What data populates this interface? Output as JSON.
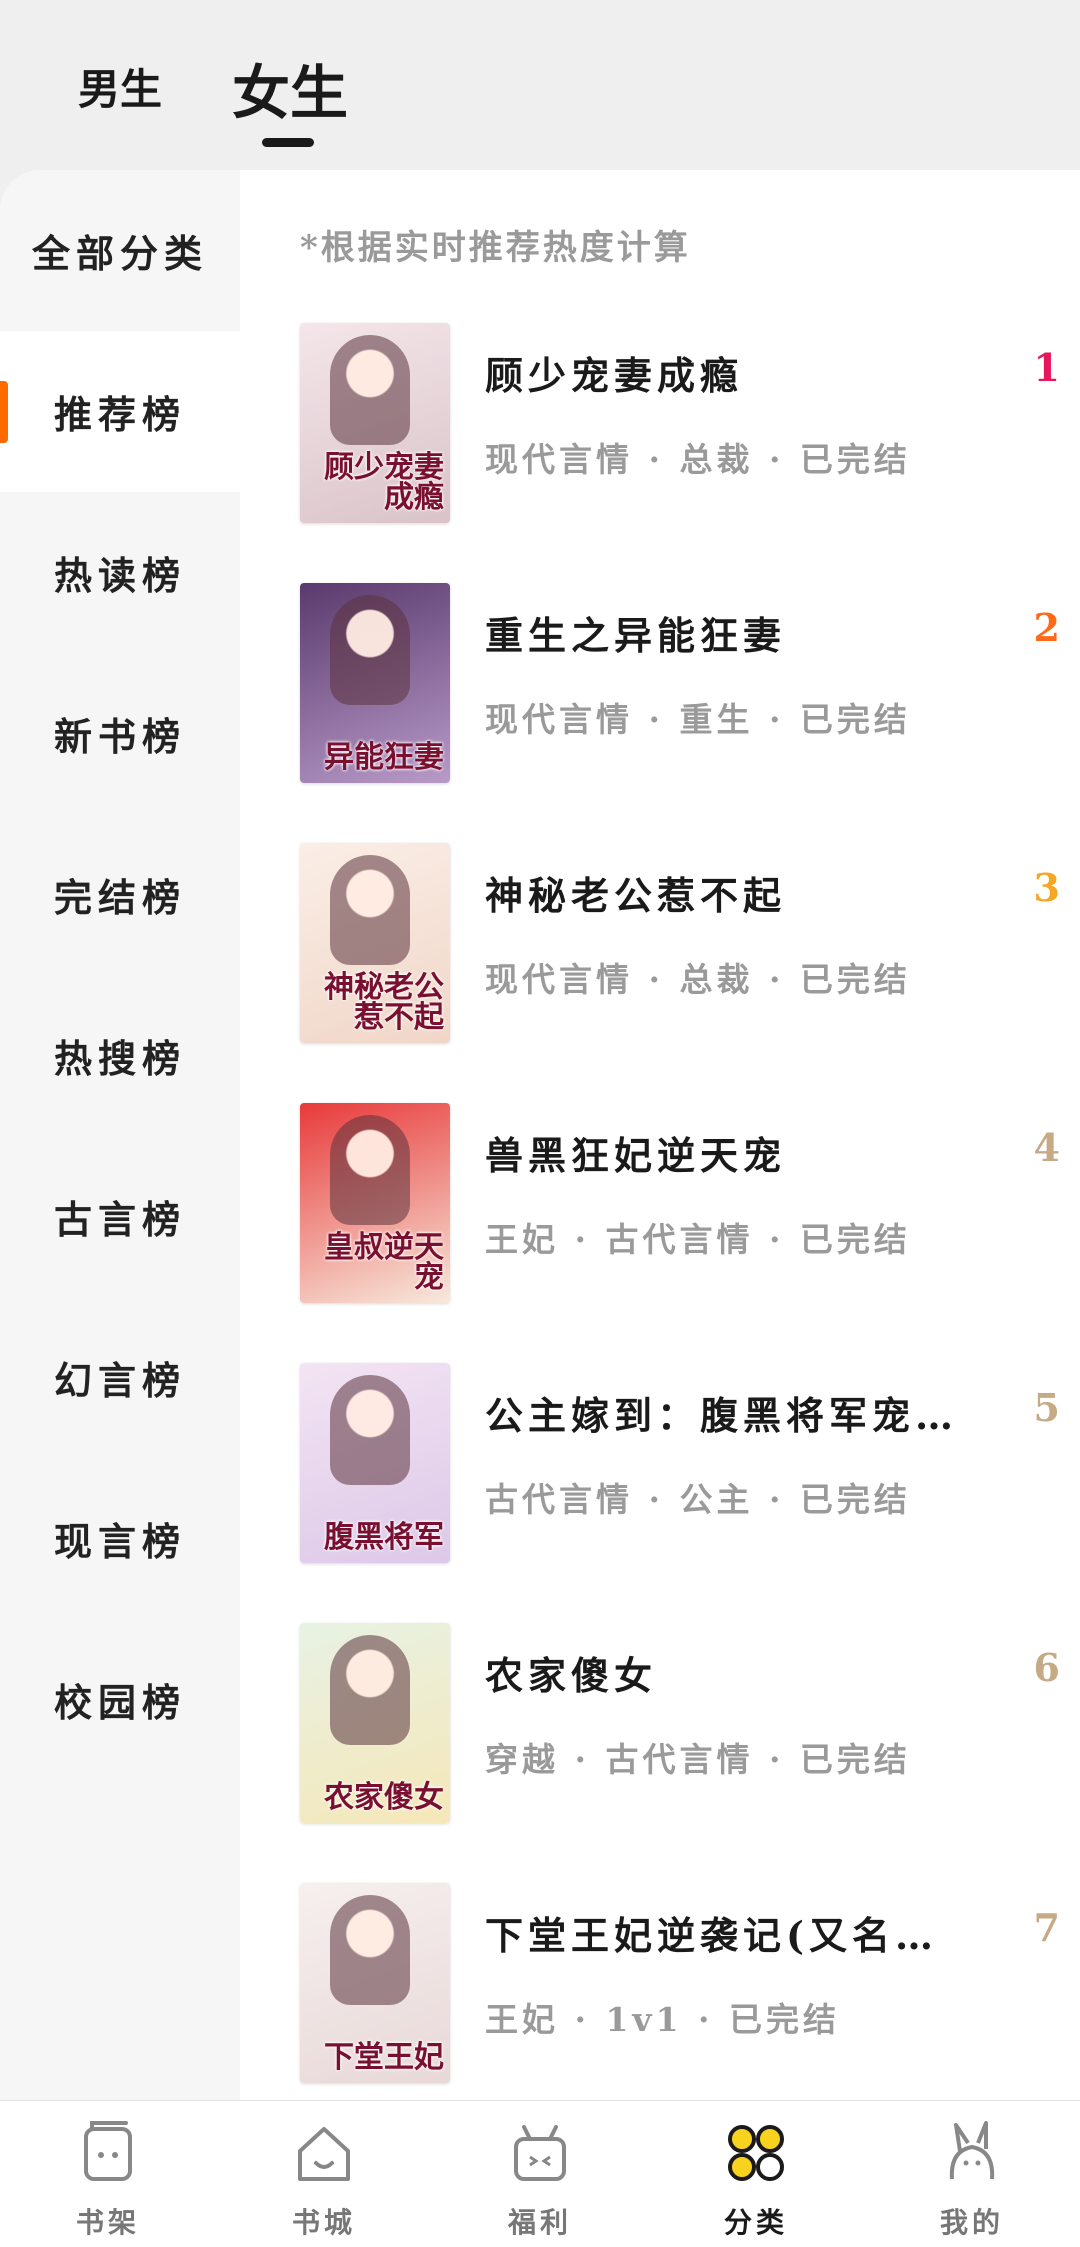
{
  "top_tabs": {
    "male": "男生",
    "female": "女生"
  },
  "sidebar": {
    "items": [
      {
        "label": "全部分类"
      },
      {
        "label": "推荐榜"
      },
      {
        "label": "热读榜"
      },
      {
        "label": "新书榜"
      },
      {
        "label": "完结榜"
      },
      {
        "label": "热搜榜"
      },
      {
        "label": "古言榜"
      },
      {
        "label": "幻言榜"
      },
      {
        "label": "现言榜"
      },
      {
        "label": "校园榜"
      }
    ],
    "active_index": 1,
    "accent_color": "#ff6a00"
  },
  "main": {
    "hint": "*根据实时推荐热度计算",
    "books": [
      {
        "rank": "1",
        "title": "顾少宠妻成瘾",
        "meta": "现代言情 · 总裁 · 已完结",
        "rank_color": "#e8175d",
        "cover_text": "顾少宠妻成瘾",
        "cover_colors": [
          "#f4e6ea",
          "#d9c3c9"
        ]
      },
      {
        "rank": "2",
        "title": "重生之异能狂妻",
        "meta": "现代言情 · 重生 · 已完结",
        "rank_color": "#ff6a1a",
        "cover_text": "异能狂妻",
        "cover_colors": [
          "#5a3a6e",
          "#b89ac8"
        ]
      },
      {
        "rank": "3",
        "title": "神秘老公惹不起",
        "meta": "现代言情 · 总裁 · 已完结",
        "rank_color": "#f5a623",
        "cover_text": "神秘老公惹不起",
        "cover_colors": [
          "#fbeee6",
          "#f0d6c8"
        ]
      },
      {
        "rank": "4",
        "title": "兽黑狂妃逆天宠",
        "meta": "王妃 · 古代言情 · 已完结",
        "rank_color": "#c6aa86",
        "cover_text": "皇叔逆天宠",
        "cover_colors": [
          "#e83a3a",
          "#f7e9dc"
        ]
      },
      {
        "rank": "5",
        "title": "公主嫁到：腹黑将军宠上天",
        "meta": "古代言情 · 公主 · 已完结",
        "rank_color": "#c6aa86",
        "cover_text": "腹黑将军",
        "cover_colors": [
          "#f3e4f3",
          "#dcc8e8"
        ]
      },
      {
        "rank": "6",
        "title": "农家傻女",
        "meta": "穿越 · 古代言情 · 已完结",
        "rank_color": "#c6aa86",
        "cover_text": "农家傻女",
        "cover_colors": [
          "#e8f2e4",
          "#f5e7b8"
        ]
      },
      {
        "rank": "7",
        "title": "下堂王妃逆袭记(又名：王妃逆袭)",
        "meta": "王妃 · 1v1 · 已完结",
        "rank_color": "#c6aa86",
        "cover_text": "下堂王妃",
        "cover_colors": [
          "#f6f0ee",
          "#e8d8d8"
        ]
      }
    ]
  },
  "bottom_nav": {
    "items": [
      {
        "label": "书架",
        "icon": "bookshelf-icon"
      },
      {
        "label": "书城",
        "icon": "bookstore-icon"
      },
      {
        "label": "福利",
        "icon": "gift-icon"
      },
      {
        "label": "分类",
        "icon": "category-icon"
      },
      {
        "label": "我的",
        "icon": "profile-icon"
      }
    ],
    "active_index": 3
  }
}
